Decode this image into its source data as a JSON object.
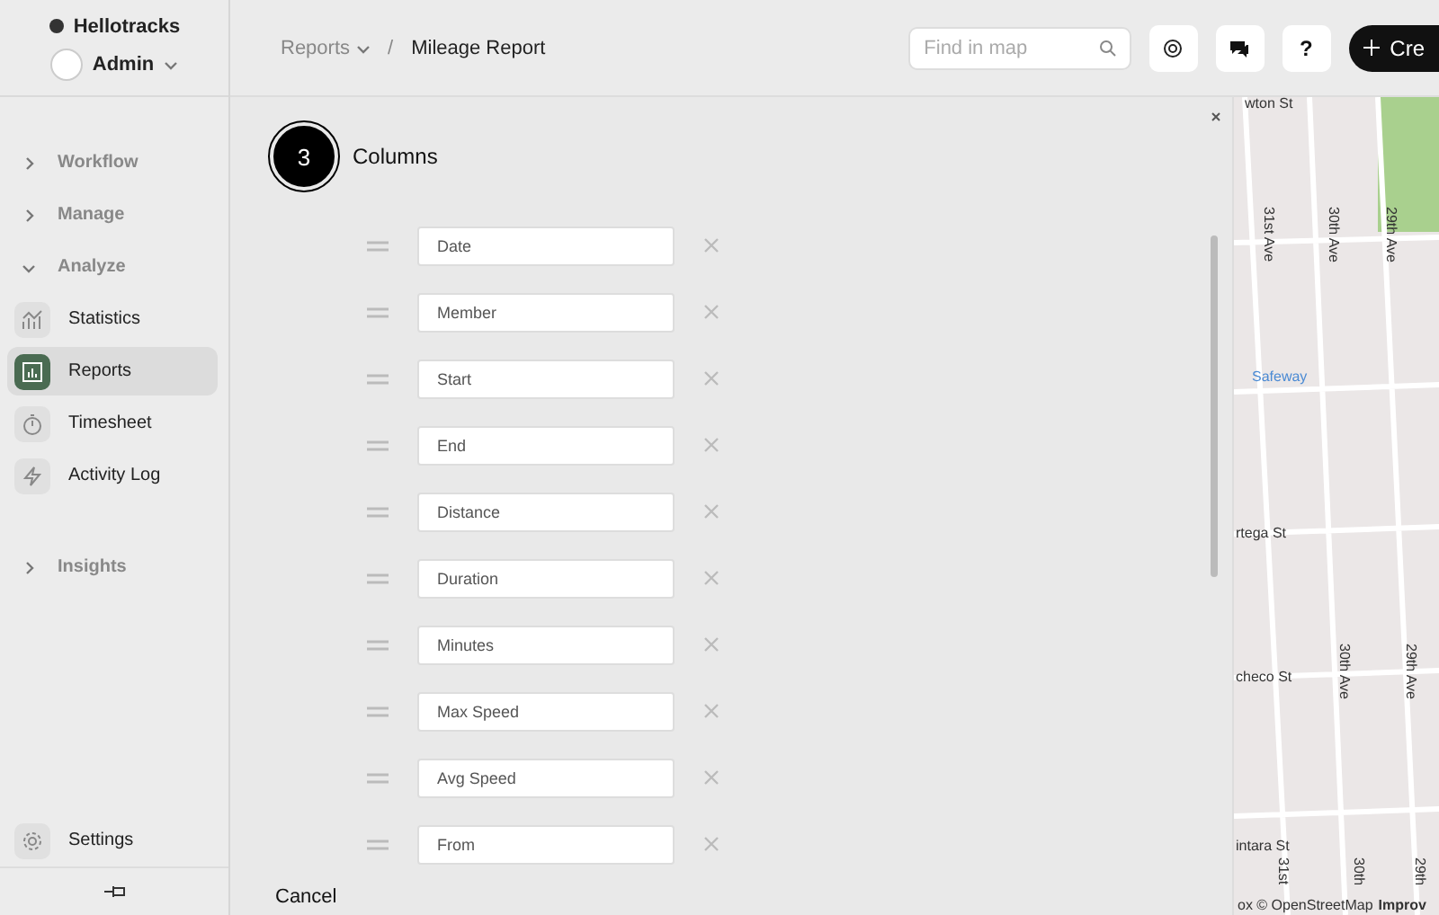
{
  "brand": {
    "name": "Hellotracks"
  },
  "account": {
    "name": "Admin"
  },
  "nav": [
    {
      "label": "Workflow",
      "expanded": false
    },
    {
      "label": "Manage",
      "expanded": false
    },
    {
      "label": "Analyze",
      "expanded": true,
      "children": [
        {
          "label": "Statistics",
          "selected": false
        },
        {
          "label": "Reports",
          "selected": true
        },
        {
          "label": "Timesheet",
          "selected": false
        },
        {
          "label": "Activity Log",
          "selected": false
        }
      ]
    },
    {
      "label": "Insights",
      "expanded": false
    }
  ],
  "settings": {
    "label": "Settings"
  },
  "breadcrumb": {
    "parent": "Reports",
    "separator": "/",
    "current": "Mileage Report"
  },
  "search": {
    "placeholder": "Find in map"
  },
  "help_button": {
    "label": "?"
  },
  "create_button": {
    "label": "Cre"
  },
  "step": {
    "number": "3",
    "title": "Columns"
  },
  "columns": [
    {
      "value": "Date"
    },
    {
      "value": "Member"
    },
    {
      "value": "Start"
    },
    {
      "value": "End"
    },
    {
      "value": "Distance"
    },
    {
      "value": "Duration"
    },
    {
      "value": "Minutes"
    },
    {
      "value": "Max Speed"
    },
    {
      "value": "Avg Speed"
    },
    {
      "value": "From"
    }
  ],
  "cancel_button": {
    "label": "Cancel"
  },
  "map": {
    "labels": [
      {
        "text": "wton St",
        "kind": "h"
      },
      {
        "text": "31st Ave",
        "kind": "v"
      },
      {
        "text": "30th Ave",
        "kind": "v"
      },
      {
        "text": "29th Ave",
        "kind": "v"
      },
      {
        "text": "Safeway",
        "kind": "poi"
      },
      {
        "text": "rtega St",
        "kind": "h"
      },
      {
        "text": "30th Ave",
        "kind": "v"
      },
      {
        "text": "29th Ave",
        "kind": "v"
      },
      {
        "text": "checo St",
        "kind": "h"
      },
      {
        "text": "intara St",
        "kind": "h"
      },
      {
        "text": "31st",
        "kind": "v"
      },
      {
        "text": "30th",
        "kind": "v"
      },
      {
        "text": "29th",
        "kind": "v"
      }
    ],
    "attribution": "ox © OpenStreetMap",
    "improve": "Improv"
  }
}
